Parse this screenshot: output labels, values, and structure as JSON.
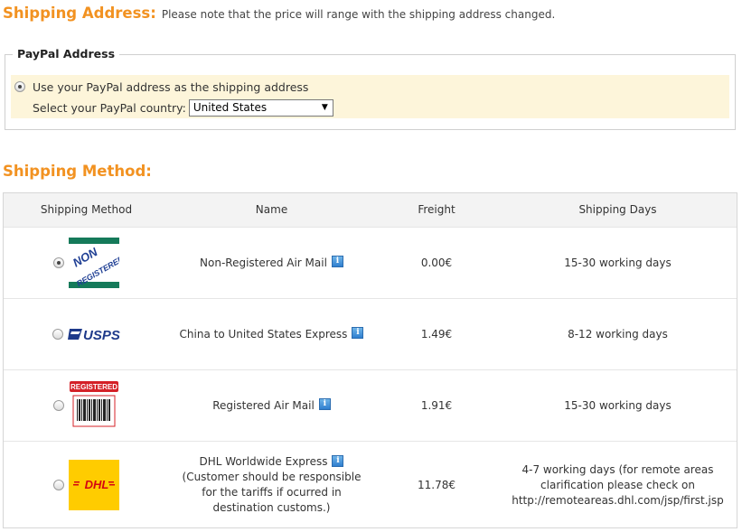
{
  "shipping_address": {
    "title": "Shipping Address:",
    "note": "Please note that the price will range with the shipping address changed.",
    "paypal_legend": "PayPal Address",
    "use_paypal_label": "Use your PayPal address as the shipping address",
    "country_label": "Select your PayPal country:",
    "country_value": "United States"
  },
  "shipping_method": {
    "title": "Shipping Method:",
    "headers": [
      "Shipping Method",
      "Name",
      "Freight",
      "Shipping Days"
    ],
    "rows": [
      {
        "logo": "non-registered-logo",
        "logo_text": "NON REGISTERED",
        "selected": true,
        "name": "Non-Registered Air Mail",
        "freight": "0.00€",
        "days": "15-30 working days"
      },
      {
        "logo": "usps-logo",
        "logo_text": "USPS",
        "selected": false,
        "name": "China to United States Express",
        "freight": "1.49€",
        "days": "8-12 working days"
      },
      {
        "logo": "registered-logo",
        "logo_text": "REGISTERED",
        "selected": false,
        "name": "Registered Air Mail",
        "freight": "1.91€",
        "days": "15-30 working days"
      },
      {
        "logo": "dhl-logo",
        "logo_text": "DHL",
        "selected": false,
        "name": "DHL Worldwide Express",
        "name_note_1": "(Customer should be responsible",
        "name_note_2": "for the tariffs if ocurred in",
        "name_note_3": "destination customs.)",
        "freight": "11.78€",
        "days": "4-7 working days (for remote areas",
        "days_2": "clarification please check on",
        "days_3": "http://remoteareas.dhl.com/jsp/first.jsp"
      }
    ]
  },
  "colors": {
    "accent": "#f29221",
    "paypal_bg": "#fdf5da",
    "header_bg": "#f3f3f3"
  }
}
